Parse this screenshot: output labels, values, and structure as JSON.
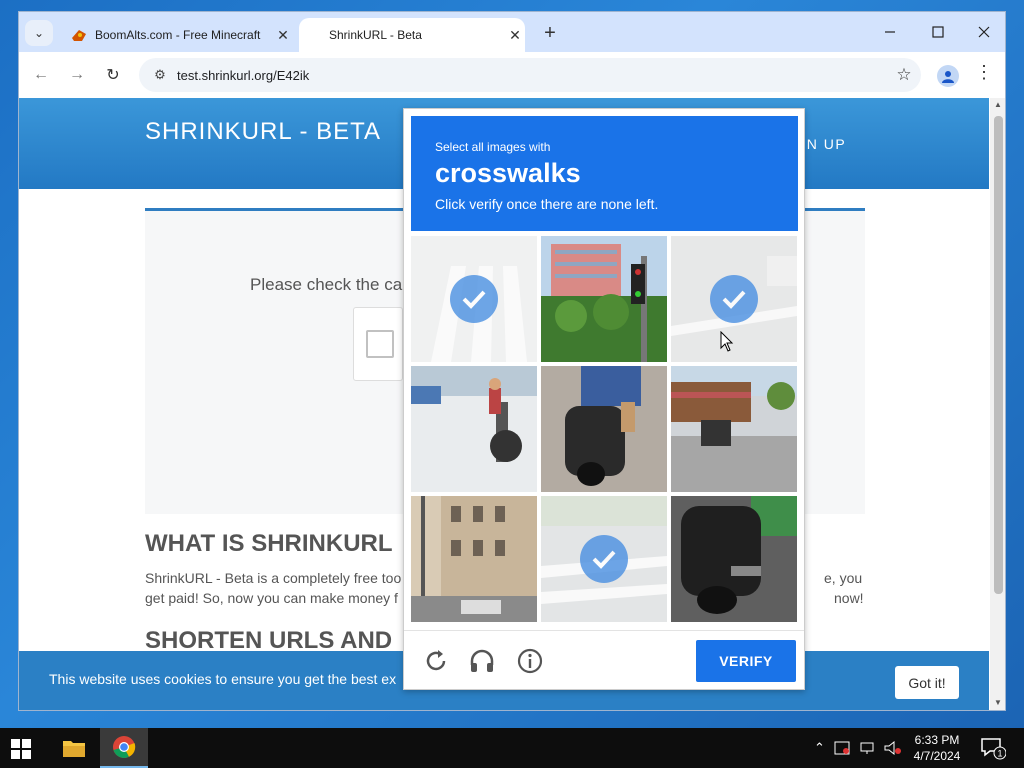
{
  "browser": {
    "tabs": [
      {
        "title": "BoomAlts.com - Free Minecraft",
        "close": "✕"
      },
      {
        "title": "ShrinkURL - Beta",
        "close": "✕"
      }
    ],
    "new_tab": "+",
    "url": "test.shrinkurl.org/E42ik",
    "window_controls": {
      "minimize": "—",
      "maximize": "☐",
      "close": "✕"
    }
  },
  "page": {
    "brand": "SHRINKURL - BETA",
    "nav_signup": "IGN UP",
    "check_prompt": "Please check the ca",
    "what_title": "WHAT IS SHRINKURL",
    "what_text_left": "ShrinkURL - Beta is a completely free too",
    "what_text_left2": "get paid! So, now you can make money f",
    "what_text_right": "e, you",
    "what_text_right2": "now!",
    "shorten_title": "SHORTEN URLS AND",
    "cookie_text": "This website uses cookies to ensure you get the best ex",
    "cookie_button": "Got it!"
  },
  "captcha": {
    "instruction": "Select all images with",
    "target": "crosswalks",
    "sub": "Click verify once there are none left.",
    "verify_label": "VERIFY",
    "tiles_selected": [
      true,
      false,
      true,
      false,
      false,
      false,
      false,
      true,
      false
    ]
  },
  "taskbar": {
    "time": "6:33 PM",
    "date": "4/7/2024",
    "notification_count": "1"
  },
  "colors": {
    "captcha_blue": "#1a73e8",
    "header_blue": "#2a84cc",
    "tabstrip": "#d3e3fd"
  }
}
